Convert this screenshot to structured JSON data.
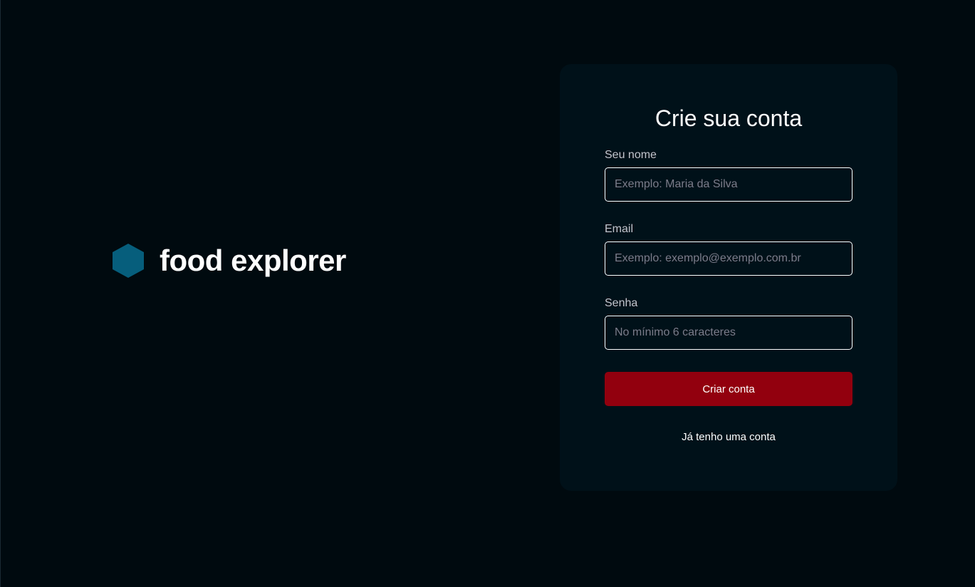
{
  "brand": {
    "name": "food explorer",
    "icon": "hexagon-logo-icon",
    "icon_color": "#065e7c"
  },
  "signup": {
    "title": "Crie sua conta",
    "fields": [
      {
        "label": "Seu nome",
        "placeholder": "Exemplo: Maria da Silva",
        "value": ""
      },
      {
        "label": "Email",
        "placeholder": "Exemplo: exemplo@exemplo.com.br",
        "value": ""
      },
      {
        "label": "Senha",
        "placeholder": "No mínimo 6 caracteres",
        "value": ""
      }
    ],
    "submit_label": "Criar conta",
    "login_link_label": "Já tenho uma conta"
  },
  "colors": {
    "background": "#000a0f",
    "card": "#001119",
    "primary_button": "#92000e",
    "label_text": "#c4c4cc",
    "placeholder_text": "#7c7c8a"
  }
}
